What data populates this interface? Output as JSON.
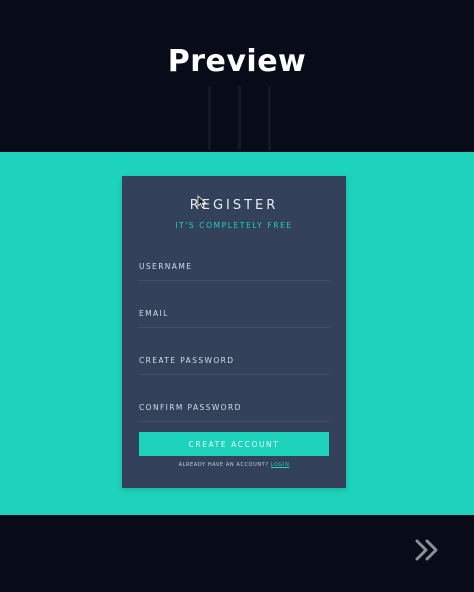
{
  "header": {
    "title": "Preview"
  },
  "form": {
    "title": "REGISTER",
    "subtitle": "IT'S COMPLETELY FREE",
    "fields": [
      {
        "label": "USERNAME"
      },
      {
        "label": "EMAIL"
      },
      {
        "label": "CREATE PASSWORD"
      },
      {
        "label": "CONFIRM PASSWORD"
      }
    ],
    "submit_label": "CREATE ACCOUNT",
    "login_prompt": "ALREADY HAVE AN ACCOUNT?",
    "login_link": "LOGIN"
  },
  "colors": {
    "background": "#080c18",
    "accent": "#1ed3bc",
    "card": "#33425a",
    "text": "#e6ebf2"
  },
  "icons": {
    "next": "double-chevron-right-icon",
    "cursor": "mouse-pointer-icon"
  }
}
